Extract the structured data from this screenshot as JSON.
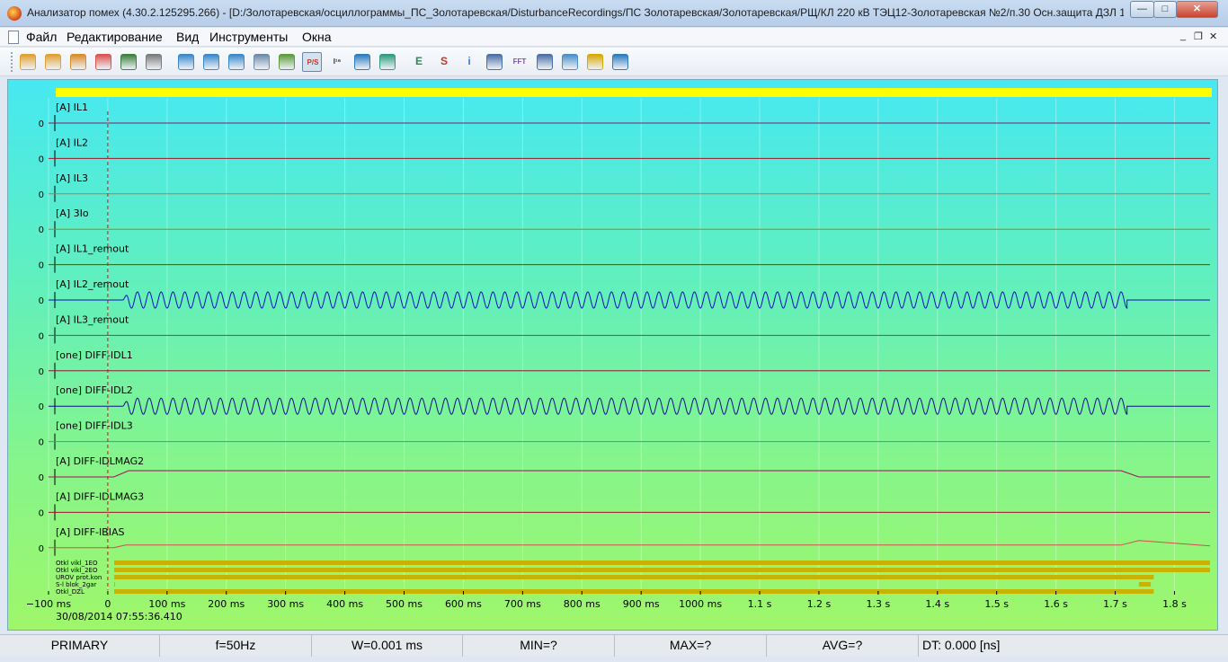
{
  "window": {
    "title": "Анализатор помех (4.30.2.125295.266) - [D:/Золотаревская/осциллограммы_ПС_Золотаревская/DisturbanceRecordings/ПС Золотаревская/Золотаревская/РЩ/КЛ 220 кВ ТЭЦ12-Золотаревская №2/п.30 Осн.защита ДЗЛ 1 к...",
    "btn_minimize": "—",
    "btn_maximize": "□",
    "btn_close": "✕"
  },
  "menu": {
    "file": "Файл",
    "edit": "Редактирование",
    "view": "Вид",
    "tools": "Инструменты",
    "windows": "Окна",
    "mdi_minimize": "_",
    "mdi_restore": "❐",
    "mdi_close": "✕"
  },
  "toolbar": {
    "items": [
      {
        "name": "open-icon",
        "color": "#e0a030"
      },
      {
        "name": "open-add-icon",
        "color": "#e0a030"
      },
      {
        "name": "open-folder-icon",
        "color": "#d98c2b"
      },
      {
        "name": "close-file-icon",
        "color": "#d9534f"
      },
      {
        "name": "save-icon",
        "color": "#3d7f3d"
      },
      {
        "name": "print-icon",
        "color": "#7a7a7a"
      },
      {
        "name": "zoom-in-icon",
        "color": "#3a88c9"
      },
      {
        "name": "zoom-out-icon",
        "color": "#3a88c9"
      },
      {
        "name": "zoom-reset-icon",
        "color": "#3a88c9"
      },
      {
        "name": "waveform-icon",
        "color": "#6e8aa8"
      },
      {
        "name": "cursor-icon",
        "color": "#5c9a3a"
      },
      {
        "name": "primary-secondary-icon",
        "color": "#c0392b",
        "label": "P/S",
        "pressed": true
      },
      {
        "name": "scale-16-icon",
        "color": "#333333",
        "label": "I¹⁶"
      },
      {
        "name": "diagram-icon",
        "color": "#2b7bbd"
      },
      {
        "name": "layout-icon",
        "color": "#2e9b7a"
      },
      {
        "name": "e-icon",
        "color": "#2e8b57",
        "label": "E"
      },
      {
        "name": "s-icon",
        "color": "#c0392b",
        "label": "S"
      },
      {
        "name": "info-icon",
        "color": "#3a7bd5",
        "label": "i"
      },
      {
        "name": "table-icon",
        "color": "#4a6fa5"
      },
      {
        "name": "fft-icon",
        "color": "#7a4fa5",
        "label": "FFT"
      },
      {
        "name": "list-icon",
        "color": "#4a6fa5"
      },
      {
        "name": "grid-icon",
        "color": "#4a8fc5"
      },
      {
        "name": "pencil-icon",
        "color": "#d6a800"
      },
      {
        "name": "phasor-icon",
        "color": "#2b7bbd"
      }
    ]
  },
  "chart_data": {
    "type": "line",
    "xlim": [
      -100,
      1860
    ],
    "x_ticks": [
      {
        "value": -100,
        "label": "−100 ms"
      },
      {
        "value": 0,
        "label": "0"
      },
      {
        "value": 100,
        "label": "100 ms"
      },
      {
        "value": 200,
        "label": "200 ms"
      },
      {
        "value": 300,
        "label": "300 ms"
      },
      {
        "value": 400,
        "label": "400 ms"
      },
      {
        "value": 500,
        "label": "500 ms"
      },
      {
        "value": 600,
        "label": "600 ms"
      },
      {
        "value": 700,
        "label": "700 ms"
      },
      {
        "value": 800,
        "label": "800 ms"
      },
      {
        "value": 900,
        "label": "900 ms"
      },
      {
        "value": 1000,
        "label": "1000 ms"
      },
      {
        "value": 1100,
        "label": "1.1 s"
      },
      {
        "value": 1200,
        "label": "1.2 s"
      },
      {
        "value": 1300,
        "label": "1.3 s"
      },
      {
        "value": 1400,
        "label": "1.4 s"
      },
      {
        "value": 1500,
        "label": "1.5 s"
      },
      {
        "value": 1600,
        "label": "1.6 s"
      },
      {
        "value": 1700,
        "label": "1.7 s"
      },
      {
        "value": 1800,
        "label": "1.8 s"
      }
    ],
    "trigger_ms": 0,
    "timestamp": "30/08/2014 07:55:36.410",
    "y_zero_label": "0",
    "series": [
      {
        "name": "[A] IL1",
        "color": "#8a1a6a",
        "shape": "flat"
      },
      {
        "name": "[A] IL2",
        "color": "#a0182a",
        "shape": "flat"
      },
      {
        "name": "[A] IL3",
        "color": "#d87020",
        "shape": "flat"
      },
      {
        "name": "[A] 3Io",
        "color": "#b08000",
        "shape": "flat"
      },
      {
        "name": "[A] IL1_remout",
        "color": "#1a6a1a",
        "shape": "flat"
      },
      {
        "name": "[A] IL2_remout",
        "color": "#1010c0",
        "shape": "sine",
        "start_ms": 25,
        "end_ms": 1720,
        "freq_hz": 50
      },
      {
        "name": "[A] IL3_remout",
        "color": "#7a3aa0",
        "shape": "flat"
      },
      {
        "name": "[one] DIFF-IDL1",
        "color": "#8a1a3a",
        "shape": "flat"
      },
      {
        "name": "[one] DIFF-IDL2",
        "color": "#101090",
        "shape": "sine",
        "start_ms": 25,
        "end_ms": 1720,
        "freq_hz": 50
      },
      {
        "name": "[one] DIFF-IDL3",
        "color": "#2aa0c0",
        "shape": "flat"
      },
      {
        "name": "[A] DIFF-IDLMAG2",
        "color": "#a01060",
        "shape": "magnitude",
        "start_ms": 20,
        "end_ms": 1730
      },
      {
        "name": "[A] DIFF-IDLMAG3",
        "color": "#a01030",
        "shape": "flat"
      },
      {
        "name": "[A] DIFF-IBIAS",
        "color": "#d05050",
        "shape": "bias",
        "start_ms": 20,
        "end_ms": 1730
      }
    ],
    "digital": [
      {
        "name": "Otkl vikl_1EO",
        "active": [
          [
            0,
            1860
          ]
        ]
      },
      {
        "name": "Otkl vikl_2EO",
        "active": [
          [
            0,
            1860
          ]
        ]
      },
      {
        "name": "UROV prot.kon",
        "active": [
          [
            0,
            1765
          ]
        ]
      },
      {
        "name": "S-l blok_2gar",
        "active": [
          [
            -100,
            -80
          ],
          [
            1740,
            1760
          ]
        ]
      },
      {
        "name": "Otkl_DZL",
        "active": [
          [
            0,
            1765
          ]
        ]
      }
    ]
  },
  "status": {
    "mode": "PRIMARY",
    "freq": "f=50Hz",
    "w": "W=0.001 ms",
    "min": "MIN=?",
    "max": "MAX=?",
    "avg": "AVG=?",
    "dt": "DT: 0.000 [ns]"
  }
}
